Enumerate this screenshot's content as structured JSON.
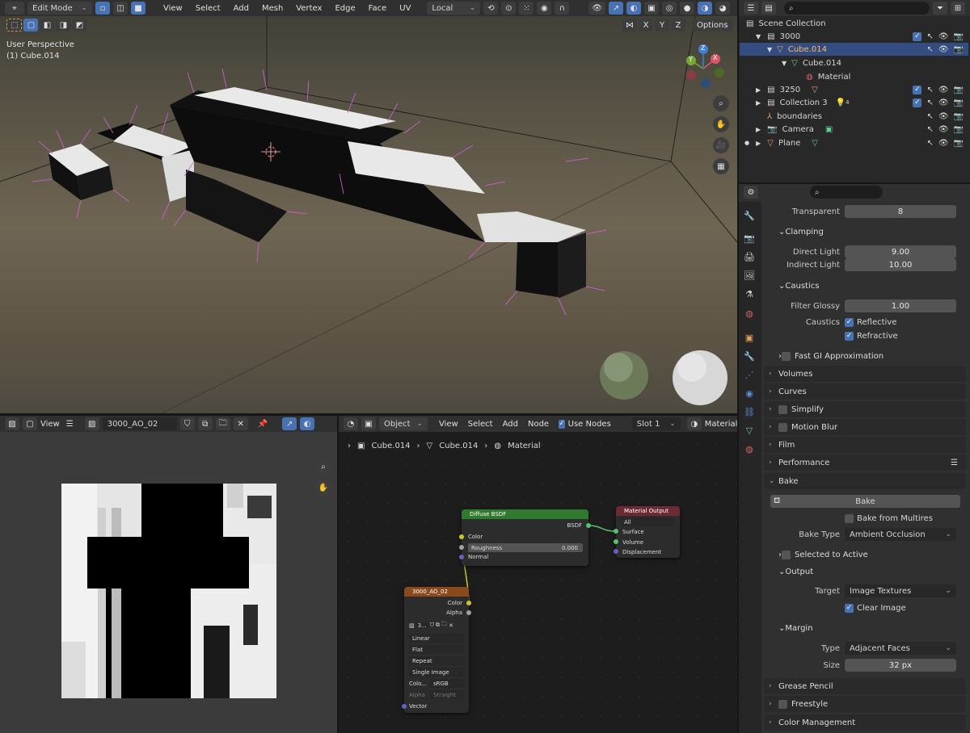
{
  "viewport": {
    "mode": "Edit Mode",
    "menu": [
      "View",
      "Select",
      "Add",
      "Mesh",
      "Vertex",
      "Edge",
      "Face",
      "UV"
    ],
    "transform_orientation": "Local",
    "options_label": "Options",
    "axis_labels": [
      "X",
      "Y",
      "Z"
    ],
    "perspective": "User Perspective",
    "object_label": "(1) Cube.014",
    "gizmo": {
      "x": "X",
      "y": "Y",
      "z": "Z"
    }
  },
  "outliner": {
    "title": "Scene Collection",
    "rows": [
      {
        "label": "3000"
      },
      {
        "label": "Cube.014"
      },
      {
        "label": "Cube.014"
      },
      {
        "label": "Material"
      },
      {
        "label": "3250"
      },
      {
        "label": "Collection 3"
      },
      {
        "label": "boundaries"
      },
      {
        "label": "Camera"
      },
      {
        "label": "Plane"
      }
    ],
    "collection3_badge": "4"
  },
  "image_editor": {
    "view_label": "View",
    "image_name": "3000_AO_02"
  },
  "node_editor": {
    "object_label": "Object",
    "menu": [
      "View",
      "Select",
      "Add",
      "Node"
    ],
    "use_nodes_label": "Use Nodes",
    "slot": "Slot 1",
    "material_label": "Material",
    "breadcrumb": [
      "Cube.014",
      "Cube.014",
      "Material"
    ],
    "diffuse": {
      "title": "Diffuse BSDF",
      "out": "BSDF",
      "color": "Color",
      "roughness": "Roughness",
      "roughness_value": "0.000",
      "normal": "Normal"
    },
    "output": {
      "title": "Material Output",
      "target": "All",
      "surface": "Surface",
      "volume": "Volume",
      "displacement": "Displacement"
    },
    "image": {
      "title": "3000_AO_02",
      "color": "Color",
      "alpha": "Alpha",
      "img_short": "3...",
      "interpolation": "Linear",
      "projection": "Flat",
      "extension": "Repeat",
      "source": "Single Image",
      "colorspace_label": "Colo...",
      "colorspace": "sRGB",
      "alpha_label": "Alpha",
      "alpha_mode": "Straight",
      "vector": "Vector"
    }
  },
  "properties": {
    "transparent_label": "Transparent",
    "transparent_value": "8",
    "clamping": "Clamping",
    "direct_label": "Direct Light",
    "direct_value": "9.00",
    "indirect_label": "Indirect Light",
    "indirect_value": "10.00",
    "caustics": "Caustics",
    "filter_glossy_label": "Filter Glossy",
    "filter_glossy_value": "1.00",
    "caustics_label": "Caustics",
    "reflective": "Reflective",
    "refractive": "Refractive",
    "fast_gi": "Fast GI Approximation",
    "sections_top": [
      "Volumes",
      "Curves",
      "Simplify",
      "Motion Blur",
      "Film",
      "Performance",
      "Bake"
    ],
    "bake_button": "Bake",
    "bake_multires": "Bake from Multires",
    "bake_type_label": "Bake Type",
    "bake_type": "Ambient Occlusion",
    "selected_to_active": "Selected to Active",
    "output": "Output",
    "target_label": "Target",
    "target_value": "Image Textures",
    "clear_image": "Clear Image",
    "margin": "Margin",
    "type_label": "Type",
    "type_value": "Adjacent Faces",
    "size_label": "Size",
    "size_value": "32 px",
    "sections_bottom": [
      "Grease Pencil",
      "Freestyle",
      "Color Management"
    ]
  },
  "colors": {
    "accent": "#4772b3",
    "selection": "#2d4f82",
    "shader_header": "#2f7a2f",
    "output_header": "#6e2a33",
    "texture_header": "#8a4a1c"
  }
}
